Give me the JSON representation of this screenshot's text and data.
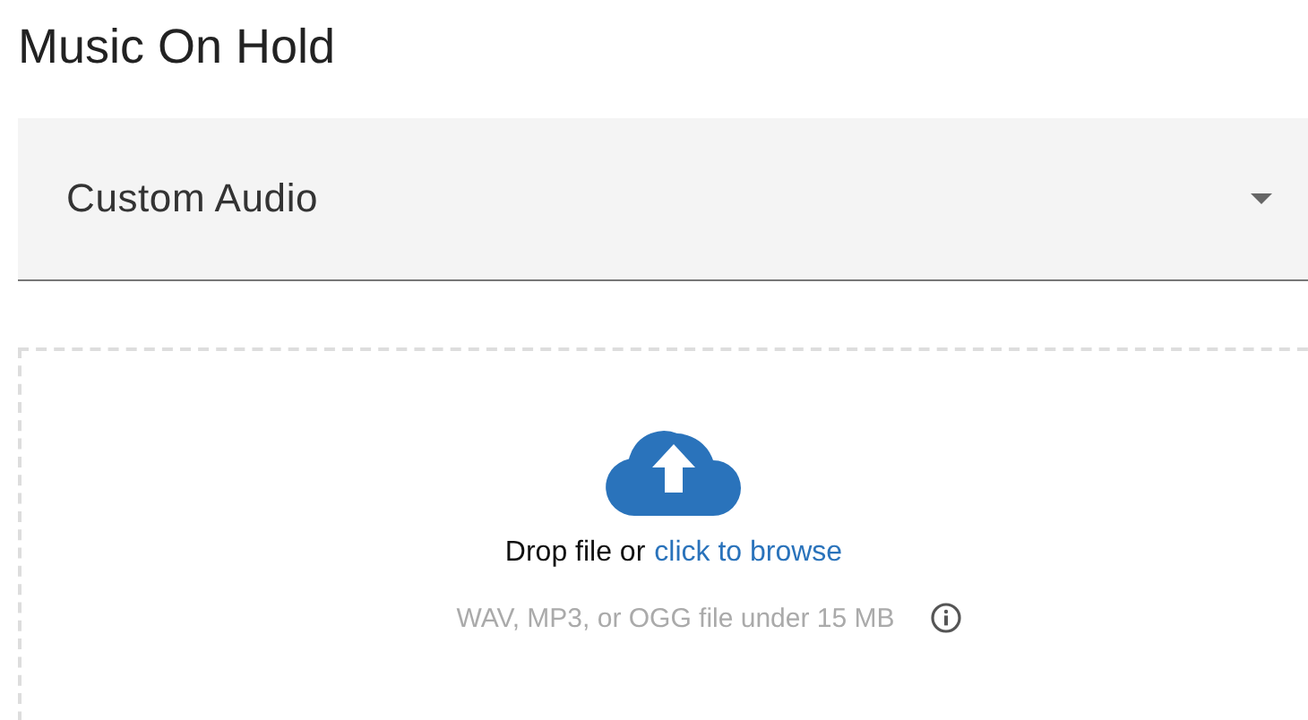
{
  "heading": "Music On Hold",
  "select": {
    "value": "Custom Audio"
  },
  "dropzone": {
    "prompt": "Drop file or",
    "link": "click to browse",
    "hint": "WAV, MP3, or OGG file under 15 MB"
  }
}
